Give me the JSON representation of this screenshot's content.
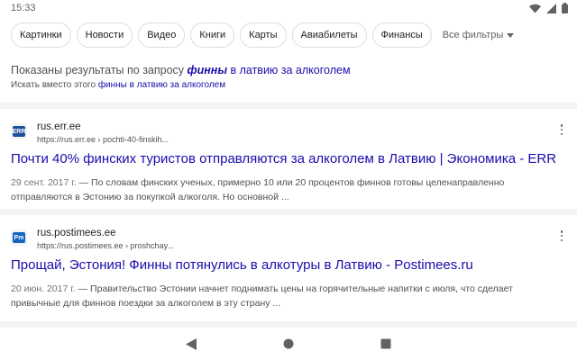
{
  "status_bar": {
    "time": "15:33",
    "icons": [
      "wifi-icon",
      "signal-icon",
      "battery-icon"
    ]
  },
  "chips": [
    {
      "label": "Картинки"
    },
    {
      "label": "Новости"
    },
    {
      "label": "Видео"
    },
    {
      "label": "Книги"
    },
    {
      "label": "Карты"
    },
    {
      "label": "Авиабилеты"
    },
    {
      "label": "Финансы"
    }
  ],
  "all_filters_label": "Все фильтры",
  "spelling": {
    "prefix": "Показаны результаты по запросу ",
    "corrected_term": "финны",
    "corrected_rest": " в латвию за алкоголем",
    "instead_prefix": "Искать вместо этого ",
    "original_query": "финны в латвию за алкоголем"
  },
  "results": [
    {
      "favicon_text": "ERR",
      "favicon_color": "#1c4f9c",
      "site_name": "rus.err.ee",
      "url": "https://rus.err.ee › pochti-40-finskih...",
      "title": "Почти 40% финских туристов отправляются за алкоголем в Латвию | Экономика - ERR",
      "date": "29 сент. 2017 г.",
      "snippet": " — По словам финских ученых, примерно 10 или 20 процентов финнов готовы целенаправленно отправляются в Эстонию за покупкой алкоголя. Но основной ..."
    },
    {
      "favicon_text": "Pm",
      "favicon_color": "#1565c0",
      "site_name": "rus.postimees.ee",
      "url": "https://rus.postimees.ee › proshchay...",
      "title": "Прощай, Эстония! Финны потянулись в алкотуры в Латвию - Postimees.ru",
      "date": "20 июн. 2017 г.",
      "snippet": " — Правительство Эстонии начнет поднимать цены на горячительные напитки с июля, что сделает привычные для финнов поездки за алкоголем в эту страну ..."
    }
  ],
  "colors": {
    "link": "#1a0dab",
    "text": "#4d5156",
    "divider": "#f1f3f4"
  },
  "nav_icons": [
    "back-icon",
    "home-icon",
    "recents-icon"
  ]
}
